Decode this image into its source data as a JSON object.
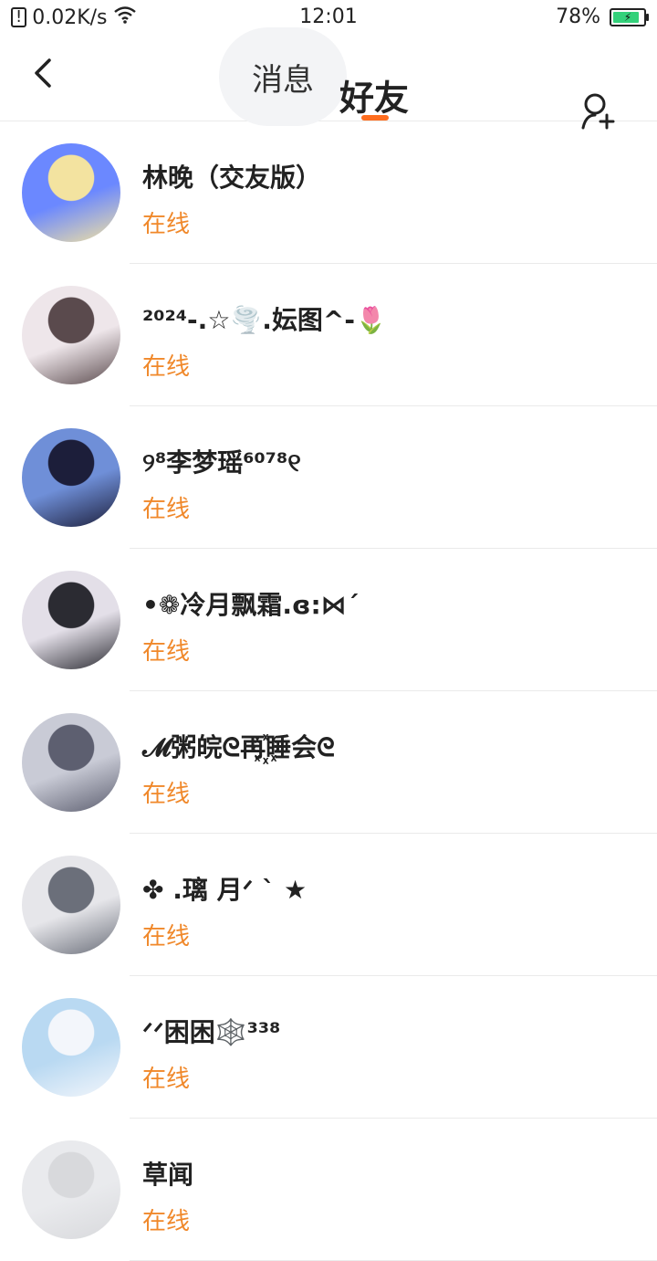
{
  "status_bar": {
    "speed": "0.02K/s",
    "time": "12:01",
    "battery": "78%"
  },
  "header": {
    "tab_messages": "消息",
    "tab_friends": "好友"
  },
  "friends": [
    {
      "name": "林晚（交友版）",
      "status": "在线",
      "avatar_colors": [
        "#6b88ff",
        "#f3e3a0"
      ]
    },
    {
      "name": "²⁰²⁴-.☆🌪️.妘图^-🌷",
      "status": "在线",
      "avatar_colors": [
        "#eee6ea",
        "#5a4a4d"
      ]
    },
    {
      "name": "୨⁸李梦瑶⁶⁰⁷⁸୧",
      "status": "在线",
      "avatar_colors": [
        "#6f8fd8",
        "#1c1e3a"
      ]
    },
    {
      "name": "•❁冷月飘霜.ɞ:⋈´",
      "status": "在线",
      "avatar_colors": [
        "#e3dfe8",
        "#2b2b32"
      ]
    },
    {
      "name": "𝓜粥皖ᘓ再꙰睡会ᘓ",
      "status": "在线",
      "avatar_colors": [
        "#c9cbd6",
        "#5d5f70"
      ]
    },
    {
      "name": "✤ .璃 月ᐟ ˋ ★",
      "status": "在线",
      "avatar_colors": [
        "#e6e6ea",
        "#6b6f7a"
      ]
    },
    {
      "name": "ᐟᐟ困困🕸️³³⁸",
      "status": "在线",
      "avatar_colors": [
        "#b9d9f2",
        "#f3f6fb"
      ]
    },
    {
      "name": "草闻",
      "status": "在线",
      "avatar_colors": [
        "#e9eaed",
        "#d8d9dc"
      ]
    }
  ]
}
